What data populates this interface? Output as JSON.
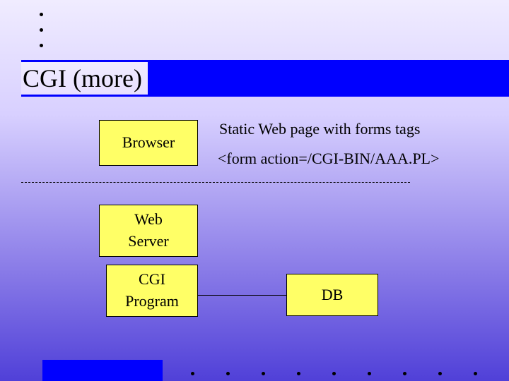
{
  "title": "CGI (more)",
  "boxes": {
    "browser": "Browser",
    "webserver_line1": "Web",
    "webserver_line2": "Server",
    "cgi_line1": "CGI",
    "cgi_line2": "Program",
    "db": "DB"
  },
  "descriptions": {
    "line1": "Static Web page with forms tags",
    "line2": "<form action=/CGI-BIN/AAA.PL>"
  }
}
